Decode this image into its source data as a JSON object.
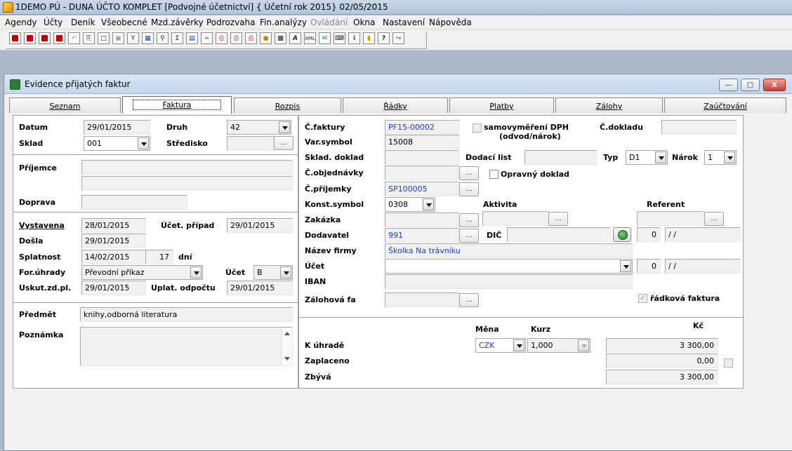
{
  "app": {
    "title": "1DEMO PÚ - DUNA ÚČTO KOMPLET [Podvojné účetnictví] { Účetní rok 2015}   02/05/2015"
  },
  "menu": [
    "Agendy",
    "Účty",
    "Deník",
    "Všeobecné",
    "Mzd.závěrky",
    "Podrozvaha",
    "Fin.analýzy",
    "Ovládání",
    "Okna",
    "Nastavení",
    "Nápověda"
  ],
  "toolbar_icons": [
    "first-record-icon",
    "prev-record-icon",
    "next-record-icon",
    "last-record-icon",
    "undo-icon",
    "copy-icon",
    "new-doc-icon",
    "blank-doc-icon",
    "save-icon",
    "filter-icon",
    "grid-icon",
    "search-icon",
    "sum-icon",
    "report-icon",
    "chart-icon",
    "print-icon",
    "printer2-icon",
    "printer3-icon",
    "export-icon",
    "preview-icon",
    "font-icon",
    "xml-icon",
    "mail-icon",
    "keyboard-icon",
    "info-icon",
    "folder-icon",
    "help-icon",
    "exit-icon"
  ],
  "window": {
    "title": "Evidence přijatých faktur"
  },
  "tabs": [
    "Seznam",
    "Faktura",
    "Rozpis",
    "Řádky",
    "Platby",
    "Zálohy",
    "Zaúčtování"
  ],
  "left": {
    "datum_label": "Datum",
    "datum": "29/01/2015",
    "druh_label": "Druh",
    "druh": "42",
    "sklad_label": "Sklad",
    "sklad": "001",
    "stredisko_label": "Středisko",
    "stredisko": "",
    "prijemce_label": "Příjemce",
    "prijemce1": "",
    "prijemce2": "",
    "doprava_label": "Doprava",
    "doprava": "",
    "vystavena_label": "Vystavena",
    "vystavena": "28/01/2015",
    "ucet_pripad_label": "Účet. případ",
    "ucet_pripad": "29/01/2015",
    "dosla_label": "Došla",
    "dosla": "29/01/2015",
    "splatnost_label": "Splatnost",
    "splatnost": "14/02/2015",
    "splatnost_dni": "17",
    "dni_label": "dní",
    "for_uhrady_label": "For.úhrady",
    "for_uhrady": "Převodní příkaz",
    "ucet_label": "Účet",
    "ucet": "B",
    "uskut_label": "Uskut.zd.pl.",
    "uskut": "29/01/2015",
    "uplat_label": "Uplat. odpočtu",
    "uplat": "29/01/2015",
    "predmet_label": "Předmět",
    "predmet": "knihy,odborná literatura",
    "poznamka_label": "Poznámka",
    "poznamka": ""
  },
  "right": {
    "c_faktury_label": "Č.faktury",
    "c_faktury": "PF15-00002",
    "samovymereni_label": "samovyměření DPH",
    "samovymereni_label2": "(odvod/nárok)",
    "c_dokladu_label": "Č.dokladu",
    "c_dokladu": "",
    "var_symbol_label": "Var.symbol",
    "var_symbol": "15008",
    "sklad_doklad_label": "Sklad. doklad",
    "sklad_doklad": "",
    "dodaci_list_label": "Dodací list",
    "dodaci_list": "",
    "typ_label": "Typ",
    "typ": "D1",
    "narok_label": "Nárok",
    "narok": "1",
    "c_objednavky_label": "Č.objednávky",
    "c_objednavky": "",
    "opravny_label": "Opravný doklad",
    "c_prijemky_label": "Č.příjemky",
    "c_prijemky": "SP100005",
    "konst_label": "Konst.symbol",
    "konst": "0308",
    "aktivita_label": "Aktivita",
    "aktivita": "",
    "referent_label": "Referent",
    "referent": "",
    "zakazka_label": "Zakázka",
    "zakazka": "",
    "dodavatel_label": "Dodavatel",
    "dodavatel": "991",
    "dic_label": "DIČ",
    "dic": "",
    "dic_num": "0",
    "dic_date": "/ /",
    "nazev_label": "Název firmy",
    "nazev": "Školka Na trávníku",
    "ucet_label": "Účet",
    "ucet": "",
    "ucet_num": "0",
    "ucet_date": "/ /",
    "iban_label": "IBAN",
    "iban": "",
    "zalohova_label": "Zálohová fa",
    "zalohova": "",
    "radkova_label": "řádková faktura",
    "mena_label": "Měna",
    "kurz_label": "Kurz",
    "kc_label": "Kč",
    "k_uhrade_label": "K úhradě",
    "mena": "CZK",
    "kurz": "1,000",
    "k_uhrade": "3 300,00",
    "zaplaceno_label": "Zaplaceno",
    "zaplaceno": "0,00",
    "zbyva_label": "Zbývá",
    "zbyva": "3 300,00"
  }
}
